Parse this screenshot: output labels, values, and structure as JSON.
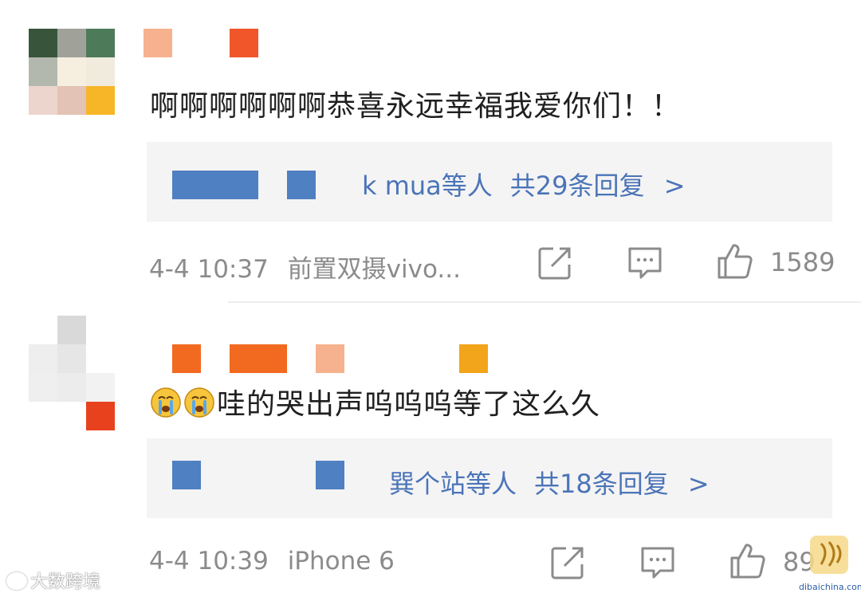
{
  "comments": [
    {
      "text": "啊啊啊啊啊啊恭喜永远幸福我爱你们！！",
      "reply_preview": {
        "names_suffix": "k mua等人",
        "count": "共29条回复",
        "chevron": ">"
      },
      "timestamp": "4-4 10:37",
      "device": "前置双摄vivo...",
      "like_count": "1589",
      "icons": [
        "share-icon",
        "comment-icon",
        "like-icon"
      ]
    },
    {
      "emoji_icon": "crying-face-icon",
      "text": "哇的哭出声呜呜呜等了这么久",
      "reply_preview": {
        "names_suffix": "巽个站等人",
        "count": "共18条回复",
        "chevron": ">"
      },
      "timestamp": "4-4 10:39",
      "device": "iPhone 6",
      "like_count": "89",
      "icons": [
        "share-icon",
        "comment-icon",
        "like-icon"
      ]
    }
  ],
  "watermark_left": "大数跨境",
  "watermark_right": "dibaichina.com",
  "colors": {
    "link": "#4b74b8",
    "meta": "#8b8b8b",
    "reply_bg": "#f4f4f4"
  }
}
